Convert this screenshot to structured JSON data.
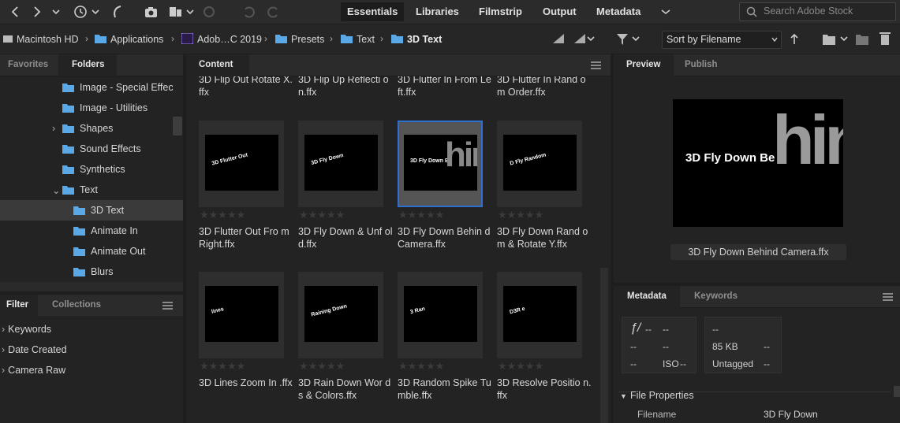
{
  "toolbar": {
    "workspaces": [
      "Essentials",
      "Libraries",
      "Filmstrip",
      "Output",
      "Metadata"
    ],
    "search_placeholder": "Search Adobe Stock"
  },
  "path": {
    "crumbs": [
      "Macintosh HD",
      "Applications",
      "Adob…C 2019",
      "Presets",
      "Text",
      "3D Text"
    ],
    "sort_label": "Sort by Filename"
  },
  "left": {
    "tabs": [
      "Favorites",
      "Folders"
    ],
    "tree": [
      {
        "label": "Image - Special Effec",
        "indent": 0,
        "arrow": ""
      },
      {
        "label": "Image - Utilities",
        "indent": 0,
        "arrow": ""
      },
      {
        "label": "Shapes",
        "indent": 0,
        "arrow": "›"
      },
      {
        "label": "Sound Effects",
        "indent": 0,
        "arrow": ""
      },
      {
        "label": "Synthetics",
        "indent": 0,
        "arrow": ""
      },
      {
        "label": "Text",
        "indent": 0,
        "arrow": "⌄"
      },
      {
        "label": "3D Text",
        "indent": 1,
        "arrow": "",
        "selected": true
      },
      {
        "label": "Animate In",
        "indent": 1,
        "arrow": ""
      },
      {
        "label": "Animate Out",
        "indent": 1,
        "arrow": ""
      },
      {
        "label": "Blurs",
        "indent": 1,
        "arrow": ""
      }
    ],
    "filter_tabs": [
      "Filter",
      "Collections"
    ],
    "filters": [
      "Keywords",
      "Date Created",
      "Camera Raw"
    ]
  },
  "content": {
    "tab": "Content",
    "top_captions": [
      "3D Flip Out Rotate X.ffx",
      "3D Flip Up Reflecti on.ffx",
      "3D Flutter In From Left.ffx",
      "3D Flutter In Rand om Order.ffx"
    ],
    "items": [
      {
        "caption": "3D Flutter Out Fro m Right.ffx",
        "art": "3D Flutter Out"
      },
      {
        "caption": "3D Fly Down & Unf old.ffx",
        "art": "3D Fly Down"
      },
      {
        "caption": "3D Fly Down Behin d Camera.ffx",
        "art": "3D Fly Down Be",
        "selected": true
      },
      {
        "caption": "3D Fly Down Rand om & Rotate Y.ffx",
        "art": "D Fly Random"
      },
      {
        "caption": "3D Lines Zoom In .ffx",
        "art": "lines"
      },
      {
        "caption": "3D Rain Down Wor ds & Colors.ffx",
        "art": "Raining Down"
      },
      {
        "caption": "3D Random Spike Tumble.ffx",
        "art": "3 Ran"
      },
      {
        "caption": "3D Resolve Positio n.ffx",
        "art": "D3R e"
      }
    ]
  },
  "preview": {
    "tabs": [
      "Preview",
      "Publish"
    ],
    "art_text": "3D Fly Down Be",
    "art_big": "hin",
    "filename": "3D Fly Down Behind Camera.ffx"
  },
  "metadata": {
    "tabs": [
      "Metadata",
      "Keywords"
    ],
    "box1": {
      "f": "ƒ/",
      "f_val": "--",
      "r1a": "--",
      "r1b": "--",
      "r2a": "--",
      "iso": "ISO",
      "iso_val": "--"
    },
    "box2": {
      "v1": "--",
      "size": "85 KB",
      "size_val": "--",
      "tag": "Untagged",
      "tag_val": "--"
    },
    "section": "File Properties",
    "rows": [
      {
        "key": "Filename",
        "value": "3D Fly Down"
      }
    ]
  },
  "colors": {
    "accent": "#2f6fd1",
    "folder": "#5aa9e6"
  }
}
